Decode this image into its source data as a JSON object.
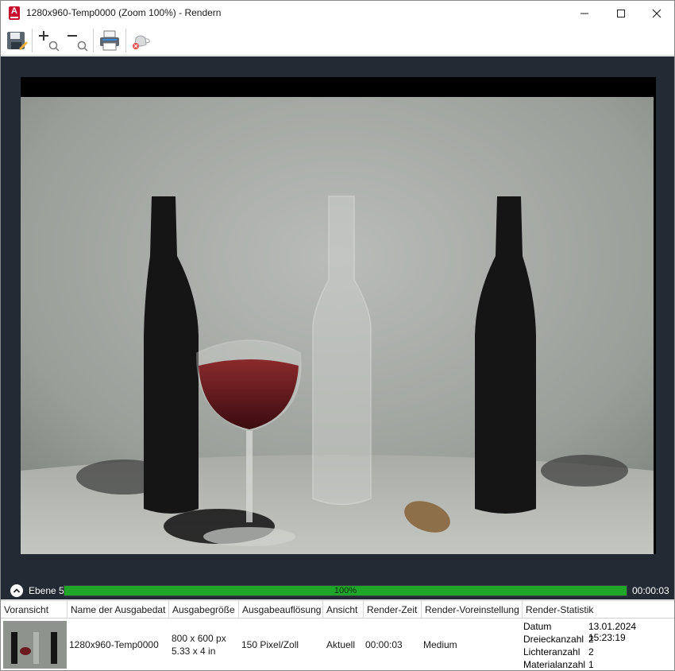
{
  "window": {
    "title": "1280x960-Temp0000 (Zoom 100%) - Rendern",
    "app_icon_letter": "A"
  },
  "toolbar": {
    "icons": [
      "save-icon",
      "zoom-in-icon",
      "zoom-out-icon",
      "print-icon",
      "cancel-render-icon"
    ]
  },
  "progress": {
    "level_label": "Ebene 5",
    "percent_text": "100%",
    "percent": 100,
    "elapsed": "00:00:03"
  },
  "history": {
    "columns": [
      "Voransicht",
      "Name der Ausgabedat",
      "Ausgabegröße",
      "Ausgabeauflösung",
      "Ansicht",
      "Render-Zeit",
      "Render-Voreinstellung",
      "Render-Statistik"
    ],
    "row": {
      "name": "1280x960-Temp0000",
      "size_px": "800 x 600 px",
      "size_in": "5.33 x 4 in",
      "resolution": "150 Pixel/Zoll",
      "view": "Aktuell",
      "render_time": "00:00:03",
      "preset": "Medium",
      "stats": [
        {
          "key": "Datum",
          "value": "13.01.2024 15:23:19"
        },
        {
          "key": "Dreieckanzahl",
          "value": "2"
        },
        {
          "key": "Lichteranzahl",
          "value": "2"
        },
        {
          "key": "Materialanzahl",
          "value": "1"
        }
      ]
    }
  },
  "colors": {
    "render_background": "#232a33",
    "progress_fill": "#1fa629",
    "brand_red": "#c8102e"
  }
}
